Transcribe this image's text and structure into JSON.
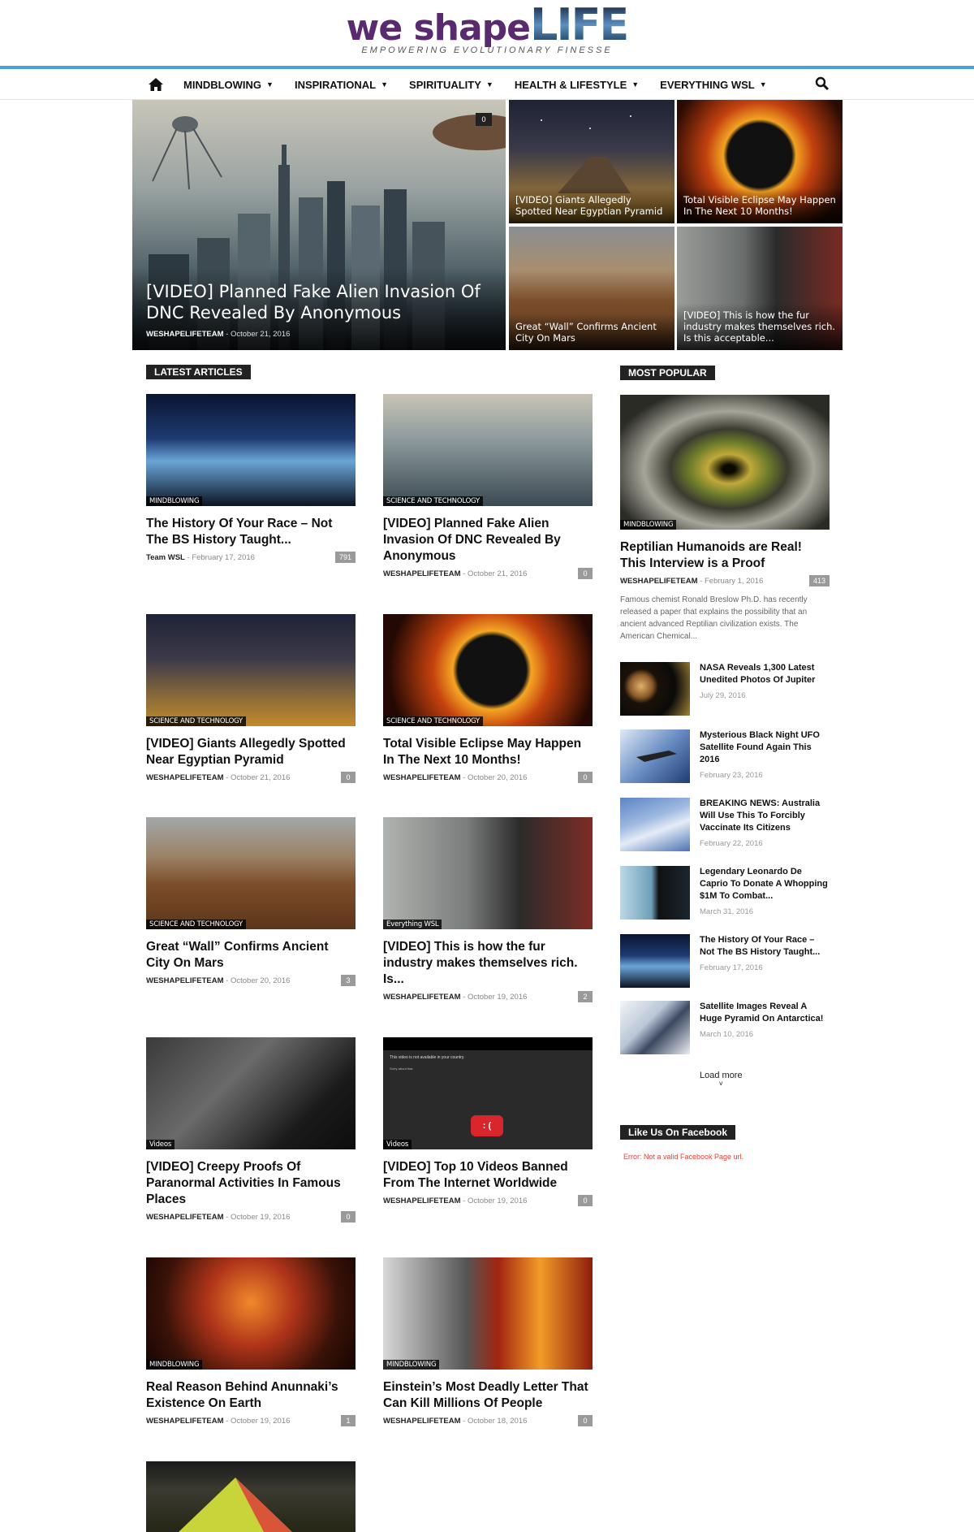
{
  "header": {
    "logo_main": "we shape",
    "logo_accent": "LIFE",
    "tagline": "EMPOWERING EVOLUTIONARY FINESSE"
  },
  "nav": {
    "items": [
      {
        "label": "MINDBLOWING"
      },
      {
        "label": "INSPIRATIONAL"
      },
      {
        "label": "SPIRITUALITY"
      },
      {
        "label": "HEALTH & LIFESTYLE"
      },
      {
        "label": "EVERYTHING WSL"
      }
    ],
    "chevron": "⌄"
  },
  "hero": {
    "big": {
      "title": "[VIDEO] Planned Fake Alien Invasion Of DNC Revealed By Anonymous",
      "author": "WESHAPELIFETEAM",
      "date": "October 21, 2016",
      "comments": "0"
    },
    "tiles": [
      {
        "title": "[VIDEO] Giants Allegedly Spotted Near Egyptian Pyramid"
      },
      {
        "title": "Total Visible Eclipse May Happen In The Next 10 Months!"
      },
      {
        "title": "Great “Wall” Confirms Ancient City On Mars"
      },
      {
        "title": "[VIDEO] This is how the fur industry makes themselves rich. Is this acceptable..."
      }
    ]
  },
  "latest": {
    "label": "LATEST ARTICLES",
    "articles": [
      {
        "category": "MINDBLOWING",
        "title": "The History Of Your Race – Not The BS History Taught...",
        "author": "Team WSL",
        "date": "February 17, 2016",
        "comments": "791"
      },
      {
        "category": "SCIENCE AND TECHNOLOGY",
        "title": "[VIDEO] Planned Fake Alien Invasion Of DNC Revealed By Anonymous",
        "author": "WESHAPELIFETEAM",
        "date": "October 21, 2016",
        "comments": "0"
      },
      {
        "category": "SCIENCE AND TECHNOLOGY",
        "title": "[VIDEO] Giants Allegedly Spotted Near Egyptian Pyramid",
        "author": "WESHAPELIFETEAM",
        "date": "October 21, 2016",
        "comments": "0"
      },
      {
        "category": "SCIENCE AND TECHNOLOGY",
        "title": "Total Visible Eclipse May Happen In The Next 10 Months!",
        "author": "WESHAPELIFETEAM",
        "date": "October 20, 2016",
        "comments": "0"
      },
      {
        "category": "SCIENCE AND TECHNOLOGY",
        "title": "Great “Wall” Confirms Ancient City On Mars",
        "author": "WESHAPELIFETEAM",
        "date": "October 20, 2016",
        "comments": "3"
      },
      {
        "category": "Everything WSL",
        "title": "[VIDEO] This is how the fur industry makes themselves rich. Is...",
        "author": "WESHAPELIFETEAM",
        "date": "October 19, 2016",
        "comments": "2"
      },
      {
        "category": "Videos",
        "title": "[VIDEO] Creepy Proofs Of Paranormal Activities In Famous Places",
        "author": "WESHAPELIFETEAM",
        "date": "October 19, 2016",
        "comments": "0"
      },
      {
        "category": "Videos",
        "title": "[VIDEO] Top 10 Videos Banned From The Internet Worldwide",
        "author": "WESHAPELIFETEAM",
        "date": "October 19, 2016",
        "comments": "0"
      },
      {
        "category": "MINDBLOWING",
        "title": "Real Reason Behind Anunnaki’s Existence On Earth",
        "author": "WESHAPELIFETEAM",
        "date": "October 19, 2016",
        "comments": "1"
      },
      {
        "category": "MINDBLOWING",
        "title": "Einstein’s Most Deadly Letter That Can Kill Millions Of People",
        "author": "WESHAPELIFETEAM",
        "date": "October 18, 2016",
        "comments": "0"
      }
    ],
    "video_unavailable": "This video is not available in your country.",
    "video_sorry": "Sorry about that."
  },
  "popular": {
    "label": "MOST POPULAR",
    "main": {
      "category": "MINDBLOWING",
      "title": "Reptilian Humanoids are Real! This Interview is a Proof",
      "author": "WESHAPELIFETEAM",
      "date": "February 1, 2016",
      "comments": "413",
      "excerpt": "Famous chemist Ronald Breslow Ph.D. has recently released a paper that explains the possibility that an ancient advanced Reptilian civilization exists. The American Chemical..."
    },
    "items": [
      {
        "title": "NASA Reveals 1,300 Latest Unedited Photos Of Jupiter",
        "date": "July 29, 2016"
      },
      {
        "title": "Mysterious Black Night UFO Satellite Found Again This 2016",
        "date": "February 23, 2016"
      },
      {
        "title": "BREAKING NEWS: Australia Will Use This To Forcibly Vaccinate Its Citizens",
        "date": "February 22, 2016"
      },
      {
        "title": "Legendary Leonardo De Caprio To Donate A Whopping $1M To Combat...",
        "date": "March 31, 2016"
      },
      {
        "title": "The History Of Your Race – Not The BS History Taught...",
        "date": "February 17, 2016"
      },
      {
        "title": "Satellite Images Reveal A Huge Pyramid On Antarctica!",
        "date": "March 10, 2016"
      }
    ],
    "load_more": "Load more"
  },
  "facebook": {
    "label": "Like Us On Facebook",
    "error": "Error: Not a valid Facebook Page url."
  },
  "colors": {
    "accent": "#4a9fde",
    "logo_purple": "#5a2a6e",
    "label_bg": "#222222",
    "error": "#e8433a"
  }
}
